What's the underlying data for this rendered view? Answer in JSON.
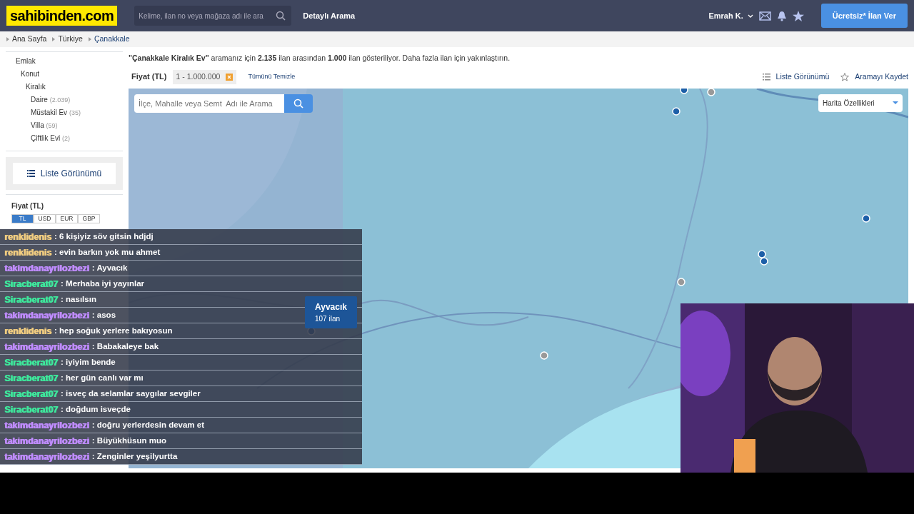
{
  "header": {
    "logo": "sahibinden.com",
    "search_placeholder": "Kelime, ilan no veya mağaza adı ile ara",
    "advanced_link": "Detaylı Arama",
    "user": "Emrah K.",
    "cta": "Ücretsiz* İlan Ver"
  },
  "breadcrumb": [
    "Ana Sayfa",
    "Türkiye",
    "Çanakkale"
  ],
  "sidebar": {
    "tree": [
      {
        "label": "Emlak",
        "children": [
          {
            "label": "Konut",
            "children": [
              {
                "label": "Kiralık",
                "children": [
                  {
                    "label": "Daire",
                    "count": "(2.039)"
                  },
                  {
                    "label": "Müstakil Ev",
                    "count": "(35)"
                  },
                  {
                    "label": "Villa",
                    "count": "(59)"
                  },
                  {
                    "label": "Çiftlik Evi",
                    "count": "(2)"
                  }
                ]
              }
            ]
          }
        ]
      }
    ],
    "list_view_button": "Liste Görünümü",
    "price_title": "Fiyat (TL)",
    "currencies": [
      {
        "label": "TL",
        "selected": true
      },
      {
        "label": "USD",
        "selected": false
      },
      {
        "label": "EUR",
        "selected": false
      },
      {
        "label": "GBP",
        "selected": false
      }
    ]
  },
  "summary": "**\"Çanakkale Kiralık Ev\"** aramanız için **2.135** ilan arasından **1.000** ilan gösteriliyor. Daha fazla ilan için yakınlaştırın.",
  "filter": {
    "label": "Fiyat (TL)",
    "value": "1 - 1.000.000",
    "clear": "Tümünü Temizle"
  },
  "actions": [
    "Liste Görünümü",
    "Aramayı Kaydet"
  ],
  "map": {
    "search_placeholder": "İlçe, Mahalle veya Semt  Adı ile Arama",
    "features_dropdown": "Harita Özellikleri",
    "tooltip": {
      "title": "Ayvacık",
      "count": "107 ilan"
    }
  },
  "chat": [
    {
      "user": "renklidenis",
      "color": "#f0cc80",
      "text": ": 6 kişiyiz söv gitsin hdjdj"
    },
    {
      "user": "renklidenis",
      "color": "#f0cc80",
      "text": ": evin barkın yok mu ahmet"
    },
    {
      "user": "takimdanayrilozbezi",
      "color": "#c08cff",
      "text": ": Ayvacık"
    },
    {
      "user": "Siracberat07",
      "color": "#3ee89c",
      "text": ": Merhaba iyi yayınlar"
    },
    {
      "user": "Siracberat07",
      "color": "#3ee89c",
      "text": ": nasılsın"
    },
    {
      "user": "takimdanayrilozbezi",
      "color": "#c08cff",
      "text": ": asos"
    },
    {
      "user": "renklidenis",
      "color": "#f0cc80",
      "text": ": hep soğuk yerlere bakıyosun"
    },
    {
      "user": "takimdanayrilozbezi",
      "color": "#c08cff",
      "text": ": Babakaleye bak"
    },
    {
      "user": "Siracberat07",
      "color": "#3ee89c",
      "text": ": iyiyim bende"
    },
    {
      "user": "Siracberat07",
      "color": "#3ee89c",
      "text": ": her gün canlı var mı"
    },
    {
      "user": "Siracberat07",
      "color": "#3ee89c",
      "text": ": isveç da selamlar saygılar sevgiler"
    },
    {
      "user": "Siracberat07",
      "color": "#3ee89c",
      "text": ": doğdum isveçde"
    },
    {
      "user": "takimdanayrilozbezi",
      "color": "#c08cff",
      "text": ": doğru yerlerdesin devam et"
    },
    {
      "user": "takimdanayrilozbezi",
      "color": "#c08cff",
      "text": ": Büyükhüsun muo"
    },
    {
      "user": "takimdanayrilozbezi",
      "color": "#c08cff",
      "text": ": Zenginler yeşilyurtta"
    }
  ],
  "webcam": {
    "kind": "picture"
  }
}
